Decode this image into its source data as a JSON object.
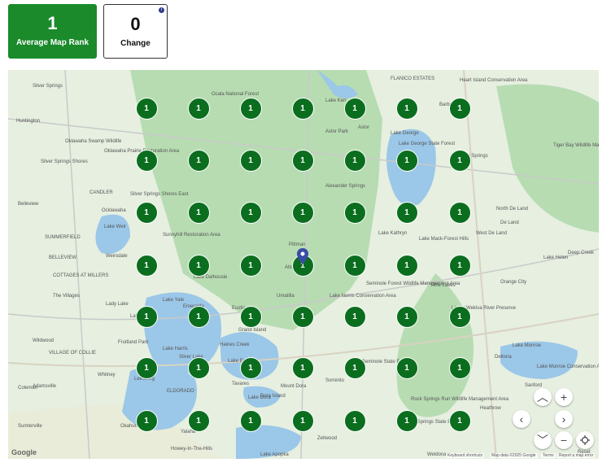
{
  "metrics": {
    "rank": {
      "value": "1",
      "label": "Average Map Rank"
    },
    "change": {
      "value": "0",
      "label": "Change",
      "info_icon": "info-icon"
    }
  },
  "grid": {
    "rank_value": "1",
    "rows": 7,
    "cols": 7,
    "pin_color": "#0b6e1f"
  },
  "places": [
    "Silver Springs",
    "Huntington",
    "Oklawaha Swamp Wildlife",
    "Silver Springs Shores",
    "Oklawaha Prairie Restoration Area",
    "CANDLER",
    "Silver Springs Shores East",
    "Ocklawaha",
    "Belleview",
    "SUMMERFIELD",
    "BELLEVIEW",
    "Weirsdale",
    "Lake Weir",
    "Sunnyhill Restoration Area",
    "COTTAGES AT MILLERS",
    "The Villages",
    "Lady Lake",
    "Emeralda",
    "Fruitland Park",
    "Wildwood",
    "VILLAGE OF COLLIE",
    "Whitney",
    "Leesburg",
    "Coleman",
    "Adamsville",
    "Sumterville",
    "Okahumpka",
    "Yalaha",
    "Howey-In-The-Hills",
    "Lake Apopka",
    "Ocala National Forest",
    "Lake Kerr",
    "FLANICO ESTATES",
    "Heart Island Conservation Area",
    "Lake George",
    "Lake George State Forest",
    "Astor Park",
    "Astor",
    "Barberville",
    "Tiger Bay Wildlife Management Area",
    "De Leon Springs",
    "Alexander Springs",
    "Pittman",
    "Altoona",
    "Lake Kathryn",
    "Lake Mack-Forest Hills",
    "North De Land",
    "De Land",
    "West De Land",
    "Deep Creek",
    "Lake Helen",
    "Orange City",
    "Seminole Forest Wildlife Management Area",
    "Pine Lakes",
    "Umatilla",
    "Lake Norris Conservation Area",
    "Eustis",
    "Grand Island",
    "Lake Eustis",
    "Tavares",
    "Lake Dora",
    "Mount Dora",
    "Dora Island",
    "Sorrento",
    "Seminole State Forest",
    "Deltona",
    "Lake Monroe",
    "Lake Monroe Conservation Area",
    "Sanford",
    "Rock Springs Run Wildlife Management Area",
    "Wekiwa Springs State Park",
    "Heathrow",
    "Lower Wekiva River Preserve",
    "Lake Yale",
    "Haines Creek",
    "Silver Lake",
    "ELDORADO",
    "Zellwood",
    "Weldona",
    "Lake Dalhousie",
    "Lake Harris",
    "Lake Griffin"
  ],
  "map": {
    "brand": "Google",
    "attribution": [
      "Keyboard shortcuts",
      "Map data ©2025 Google",
      "Terms",
      "Report a map error"
    ],
    "controls": {
      "zoom_in": "+",
      "zoom_out": "−",
      "up": "︿",
      "down": "﹀",
      "left": "‹",
      "right": "›",
      "reset_label": "Reset"
    }
  }
}
